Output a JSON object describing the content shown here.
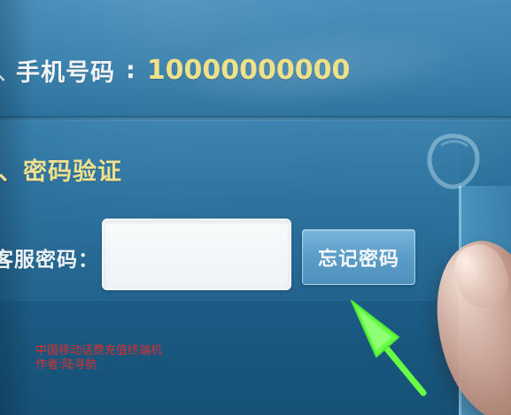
{
  "phone": {
    "prefix": "、",
    "label": "手机号码",
    "colon": ":",
    "number": "10000000000"
  },
  "verification": {
    "heading": "、密码验证",
    "password_label": "客服密码：",
    "password_value": "",
    "forgot_password_label": "忘记密码"
  },
  "watermark": {
    "line1": "中国移动话费充值终端机",
    "line2": "作者:陆寻航"
  },
  "icons": {
    "brand_icon": "signal-head-icon",
    "arrow_icon": "green-arrow-pointer"
  },
  "colors": {
    "screen_blue": "#2f6f97",
    "highlight_yellow": "#efe18f",
    "button_blue": "#5d9ec8",
    "input_white": "#f9fbfc",
    "watermark_red": "#d62d2d",
    "arrow_green": "#60ff3b"
  }
}
